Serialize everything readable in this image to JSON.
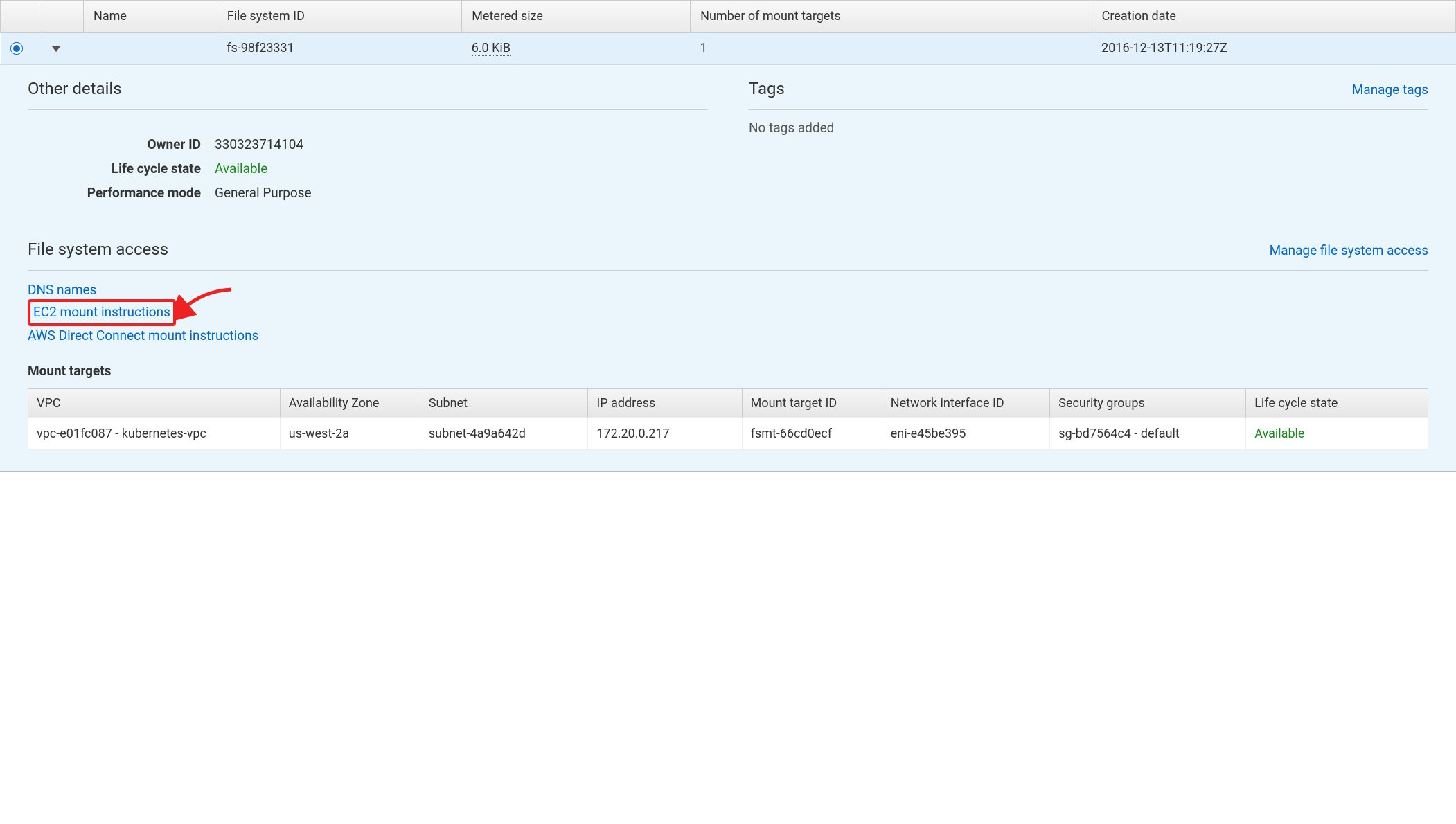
{
  "columns": {
    "name": "Name",
    "file_system_id": "File system ID",
    "metered_size": "Metered size",
    "mount_targets": "Number of mount targets",
    "creation_date": "Creation date"
  },
  "row": {
    "name": "",
    "file_system_id": "fs-98f23331",
    "metered_size": "6.0 KiB",
    "mount_targets": "1",
    "creation_date": "2016-12-13T11:19:27Z"
  },
  "other_details": {
    "title": "Other details",
    "owner_id_label": "Owner ID",
    "owner_id": "330323714104",
    "life_cycle_label": "Life cycle state",
    "life_cycle": "Available",
    "perf_mode_label": "Performance mode",
    "perf_mode": "General Purpose"
  },
  "tags": {
    "title": "Tags",
    "manage": "Manage tags",
    "empty": "No tags added"
  },
  "fs_access": {
    "title": "File system access",
    "manage": "Manage file system access",
    "links": {
      "dns": "DNS names",
      "ec2": "EC2 mount instructions",
      "dc": "AWS Direct Connect mount instructions"
    }
  },
  "mount_targets": {
    "title": "Mount targets",
    "cols": {
      "vpc": "VPC",
      "az": "Availability Zone",
      "subnet": "Subnet",
      "ip": "IP address",
      "mt_id": "Mount target ID",
      "nif": "Network interface ID",
      "sg": "Security groups",
      "state": "Life cycle state"
    },
    "rows": [
      {
        "vpc": "vpc-e01fc087 - kubernetes-vpc",
        "az": "us-west-2a",
        "subnet": "subnet-4a9a642d",
        "ip": "172.20.0.217",
        "mt_id": "fsmt-66cd0ecf",
        "nif": "eni-e45be395",
        "sg": "sg-bd7564c4 - default",
        "state": "Available"
      }
    ]
  }
}
